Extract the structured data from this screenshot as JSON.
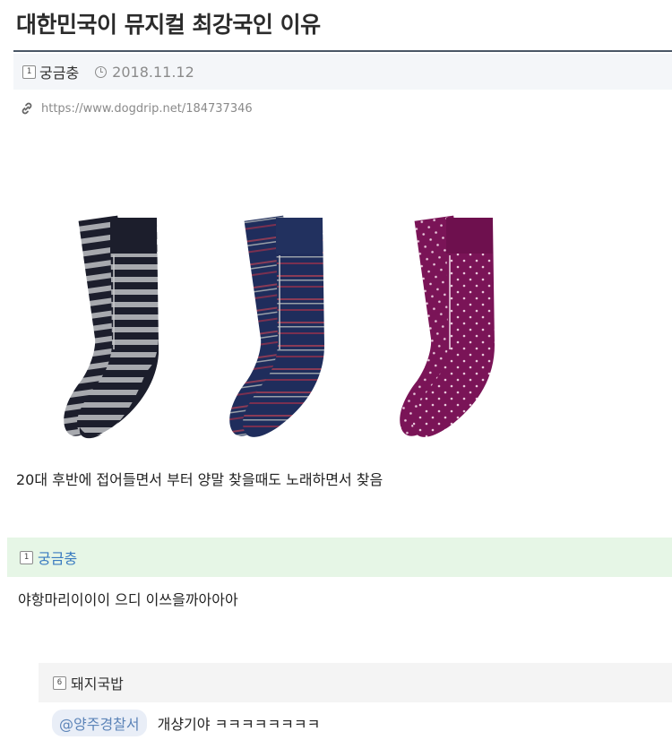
{
  "post": {
    "title": "대한민국이 뮤지컬 최강국인 이유",
    "author_level": "1",
    "author": "궁금충",
    "date": "2018.11.12",
    "url": "https://www.dogdrip.net/184737346",
    "body": "20대 후반에 접어들면서 부터 양말 찾을때도 노래하면서 찾음",
    "image": {
      "items": [
        {
          "name": "striped-sock-pair",
          "color": "#1c1e2c",
          "pattern": "stripes"
        },
        {
          "name": "navy-sock-pair",
          "color": "#1f2d5c",
          "pattern": "thin-stripes"
        },
        {
          "name": "purple-dot-sock-pair",
          "color": "#7a1457",
          "pattern": "dots"
        }
      ]
    }
  },
  "comments": [
    {
      "author_level": "1",
      "author": "궁금충",
      "text": "야항마리이이이 으디 이쓰을까아아아",
      "highlight_color": "#e6f6e6"
    }
  ],
  "replies": [
    {
      "author_level": "6",
      "author": "돼지국밥",
      "mention": "@양주경찰서",
      "text": "개샹기야 ㅋㅋㅋㅋㅋㅋㅋㅋ"
    }
  ],
  "colors": {
    "title_rule": "#4a5766",
    "link": "#3a7bc0"
  }
}
